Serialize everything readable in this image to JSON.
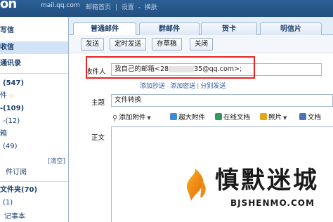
{
  "header": {
    "logo_text": "on",
    "domain": "mail.qq.com",
    "links": [
      "邮箱首页",
      "|",
      "设置",
      "-",
      "换肤"
    ]
  },
  "sidebar": {
    "items": [
      {
        "label": "写信",
        "active": false
      },
      {
        "label": "收信",
        "active": true
      },
      {
        "label": "通讯录",
        "active": false
      },
      {
        "label": "(547)",
        "active": false
      },
      {
        "label": "件",
        "star": "☆"
      },
      {
        "label": "-(109)",
        "active": false
      },
      {
        "label": "-(12)",
        "active": false
      },
      {
        "label": "箱",
        "active": false
      },
      {
        "label": "(49)",
        "active": false
      },
      {
        "label": "[清空]",
        "active": false
      },
      {
        "label": "件订阅",
        "active": false
      },
      {
        "label": "文件夹(70)",
        "active": false
      },
      {
        "label": "(1)",
        "active": false
      },
      {
        "label": "记事本",
        "active": false
      }
    ]
  },
  "tabs": [
    "普通邮件",
    "群邮件",
    "贺卡",
    "明信片"
  ],
  "toolbar": {
    "send": "发送",
    "scheduled": "定时发送",
    "draft": "存草稿",
    "close": "关闭"
  },
  "compose": {
    "to_label": "收件人",
    "to_value_prefix": "我自己的邮箱<28",
    "to_value_suffix": "35@qq.com>;",
    "cc_add": "添加抄送",
    "bcc_add": "添加密送",
    "separate_send": "分别发送",
    "subject_label": "主题",
    "subject_value": "文件转换",
    "body_label": "正文"
  },
  "attachments": {
    "add_attachment": "添加附件",
    "large_attachment": "超大附件",
    "online_doc": "在线文档",
    "photo": "照片",
    "document": "文档"
  },
  "watermark": {
    "title": "慎默迷城",
    "url": "BJSHENMO.COM"
  },
  "colors": {
    "header_bg": "#2b5f95",
    "highlight_border": "#e8231f",
    "tab_bg": "#e4eef9"
  }
}
